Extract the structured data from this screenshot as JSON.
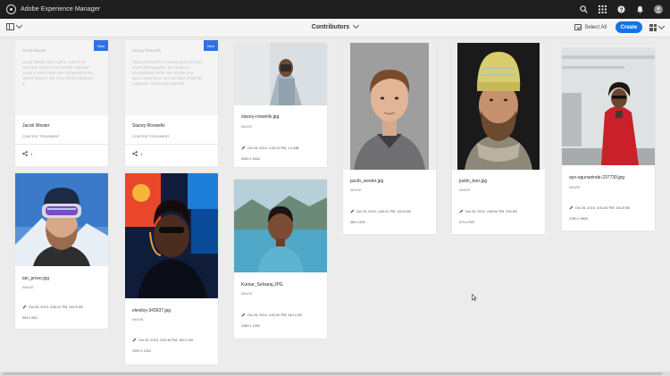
{
  "shell": {
    "app_title": "Adobe Experience Manager",
    "icons": [
      "search-icon",
      "apps-grid-icon",
      "help-icon",
      "bell-icon",
      "user-avatar"
    ]
  },
  "actionbar": {
    "breadcrumb": "Contributors",
    "select_all": "Select All",
    "create": "Create"
  },
  "colors": {
    "accent": "#1473e6",
    "shell": "#1e1e1e",
    "badge": "#2d73e4"
  },
  "fragments": [
    {
      "head": "Jacob Wester",
      "body": "Jacob Wester, born April 1, 1990 is an American writer for the WKND magazine. Jacob is also a skier who competed for the United States in the 2014 Winter Olympics in",
      "badge": "New",
      "title": "Jacob Wester",
      "type": "CONTENT FRAGMENT",
      "links": "1"
    },
    {
      "head": "Stacey Roswells",
      "body": "Stacey Roswells is a well known American action photographer. She is also an accomplished turtle rock climber and alpine adventurer. As a member of WKND magazine, Stacey has travelled",
      "badge": "New",
      "title": "Stacey Roswells",
      "type": "CONTENT FRAGMENT",
      "links": "1"
    }
  ],
  "assets": [
    {
      "title": "stacey-roswells.jpg",
      "type": "IMAGE",
      "date": "Oct 25, 2019, 4:49:13 PM",
      "size": "1.6 MB",
      "dims": "5280 x 3344"
    },
    {
      "title": "jacob_wester.jpg",
      "type": "IMAGE",
      "date": "Oct 25, 2019, 4:50:41 PM",
      "size": "103.5 KB",
      "dims": "480 x 600"
    },
    {
      "title": "justin_barr.jpg",
      "type": "IMAGE",
      "date": "Oct 25, 2019, 4:50:54 PM",
      "size": "228 KB",
      "dims": "473 x 599"
    },
    {
      "title": "ayo-ogunseinde-237739.jpg",
      "type": "IMAGE",
      "date": "Oct 25, 2019, 4:51:46 PM",
      "size": "430.8 KB",
      "dims": "3780 x 3840"
    },
    {
      "title": "ian_provo.jpg",
      "type": "IMAGE",
      "date": "Oct 25, 2019, 4:50:22 PM",
      "size": "245.5 KB",
      "dims": "552 x 552"
    },
    {
      "title": "elevitsy-343937.jpg",
      "type": "IMAGE",
      "date": "Oct 25, 2019, 4:51:38 PM",
      "size": "160.1 KB",
      "dims": "1000 x 1244"
    },
    {
      "title": "Kumar_Selvaraj.JPG",
      "type": "IMAGE",
      "date": "Oct 25, 2019, 4:51:50 PM",
      "size": "240.4 KB",
      "dims": "1280 x 1280"
    }
  ]
}
